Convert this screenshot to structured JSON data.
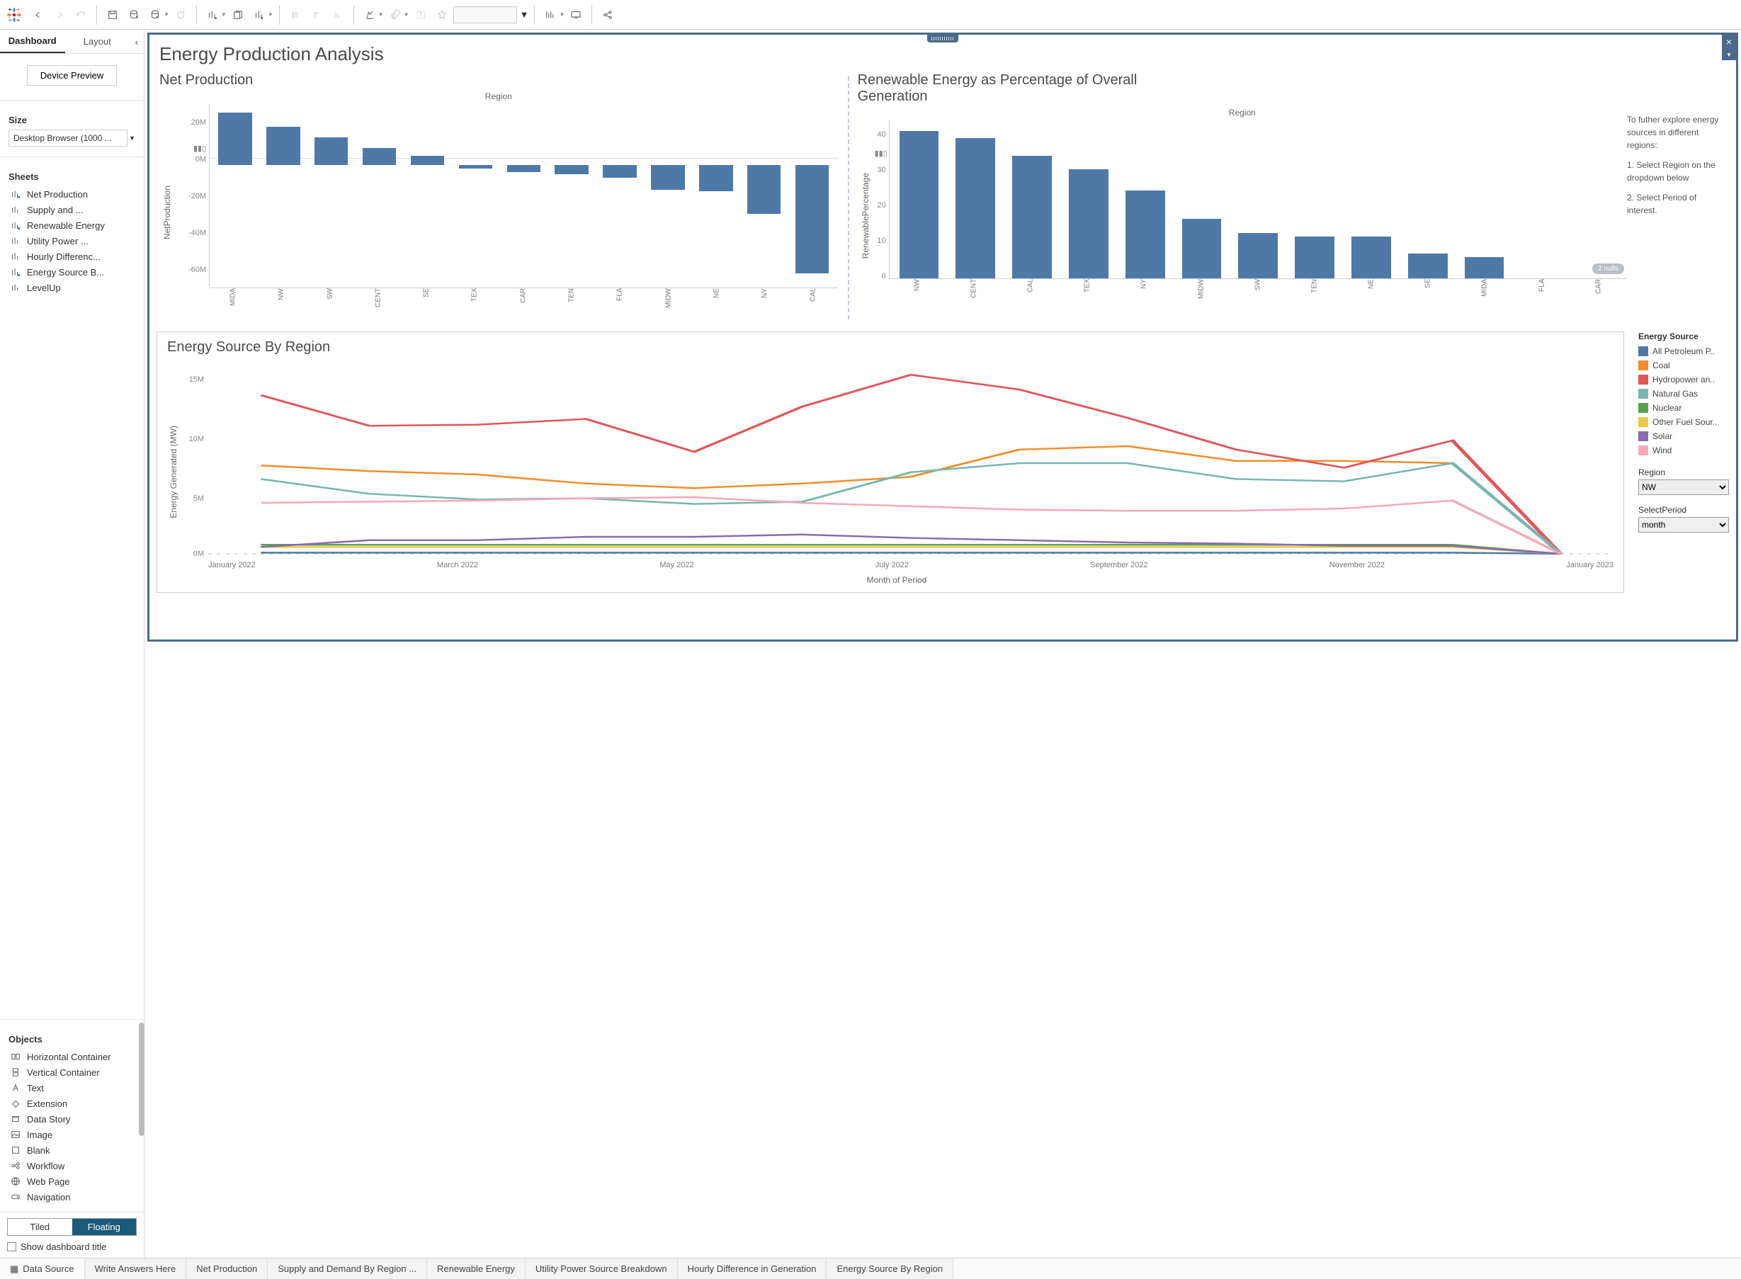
{
  "toolbar": {
    "filter_box": ""
  },
  "left_panel": {
    "tabs": {
      "dashboard": "Dashboard",
      "layout": "Layout"
    },
    "device_preview": "Device Preview",
    "size_heading": "Size",
    "size_value": "Desktop Browser (1000 ...",
    "sheets_heading": "Sheets",
    "sheets": [
      {
        "name": "Net Production"
      },
      {
        "name": "Supply and ..."
      },
      {
        "name": "Renewable Energy"
      },
      {
        "name": "Utility Power ..."
      },
      {
        "name": "Hourly Differenc..."
      },
      {
        "name": "Energy Source B..."
      },
      {
        "name": "LevelUp"
      }
    ],
    "objects_heading": "Objects",
    "objects": [
      {
        "name": "Horizontal Container"
      },
      {
        "name": "Vertical Container"
      },
      {
        "name": "Text"
      },
      {
        "name": "Extension"
      },
      {
        "name": "Data Story"
      },
      {
        "name": "Image"
      },
      {
        "name": "Blank"
      },
      {
        "name": "Workflow"
      },
      {
        "name": "Web Page"
      },
      {
        "name": "Navigation"
      }
    ],
    "toggle": {
      "tiled": "Tiled",
      "floating": "Floating"
    },
    "show_title": "Show dashboard title"
  },
  "dashboard": {
    "title": "Energy Production Analysis",
    "net_production": {
      "title": "Net Production",
      "region_label": "Region",
      "y_axis_label": "NetProduction",
      "y_ticks": [
        "20M",
        "0M",
        "-20M",
        "-40M",
        "-60M"
      ]
    },
    "renewable": {
      "title": "Renewable Energy as Percentage of Overall Generation",
      "region_label": "Region",
      "y_axis_label": "RenewablePercentage",
      "y_ticks": [
        "40",
        "30",
        "20",
        "10",
        "0"
      ],
      "nulls_badge": "2 nulls"
    },
    "side_text": {
      "p1": "To futher explore energy sources in different regions:",
      "p2": "1. Select Region on the dropdown below",
      "p3": "2. Select Period of interest."
    },
    "energy_source": {
      "title": "Energy Source By Region",
      "y_axis_label": "Energy Generated (MW)",
      "y_ticks": [
        "15M",
        "10M",
        "5M",
        "0M"
      ],
      "x_axis_caption": "Month of Period",
      "x_labels": [
        "January 2022",
        "March 2022",
        "May 2022",
        "July 2022",
        "September 2022",
        "November 2022",
        "January 2023"
      ]
    },
    "legend": {
      "title": "Energy Source",
      "items": [
        {
          "name": "All Petroleum P..",
          "color": "#4e79a7"
        },
        {
          "name": "Coal",
          "color": "#f28e2b"
        },
        {
          "name": "Hydropower an..",
          "color": "#e15759"
        },
        {
          "name": "Natural Gas",
          "color": "#76b7b2"
        },
        {
          "name": "Nuclear",
          "color": "#59a14f"
        },
        {
          "name": "Other Fuel Sour..",
          "color": "#edc948"
        },
        {
          "name": "Solar",
          "color": "#8b6bb0"
        },
        {
          "name": "Wind",
          "color": "#f7a8b8"
        }
      ]
    },
    "filters": {
      "region_label": "Region",
      "region_value": "NW",
      "period_label": "SelectPeriod",
      "period_value": "month"
    }
  },
  "bottom_tabs": {
    "data_source": "Data Source",
    "tabs": [
      "Write Answers Here",
      "Net Production",
      "Supply and Demand By Region ...",
      "Renewable Energy",
      "Utility Power Source Breakdown",
      "Hourly Difference in Generation",
      "Energy Source By Region"
    ]
  },
  "chart_data": [
    {
      "type": "bar",
      "title": "Net Production",
      "ylabel": "NetProduction",
      "ylim": [
        -70000000,
        35000000
      ],
      "categories": [
        "MIDA",
        "NW",
        "SW",
        "CENT",
        "SE",
        "TEX",
        "CAR",
        "TEN",
        "FLA",
        "MIDW",
        "NE",
        "NY",
        "CAL"
      ],
      "values": [
        30000000,
        22000000,
        16000000,
        10000000,
        5500000,
        -2000000,
        -4000000,
        -5000000,
        -7000000,
        -14000000,
        -15000000,
        -28000000,
        -62000000
      ]
    },
    {
      "type": "bar",
      "title": "Renewable Energy as Percentage of Overall Generation",
      "ylabel": "RenewablePercentage",
      "ylim": [
        0,
        45
      ],
      "categories": [
        "NW",
        "CENT",
        "CAL",
        "TEX",
        "NY",
        "MIDW",
        "SW",
        "TEN",
        "NE",
        "SE",
        "MIDA",
        "FLA",
        "CAR"
      ],
      "values": [
        42,
        40,
        35,
        31,
        25,
        17,
        13,
        12,
        12,
        7,
        6,
        null,
        null
      ]
    },
    {
      "type": "line",
      "title": "Energy Source By Region",
      "xlabel": "Month of Period",
      "ylabel": "Energy Generated (MW)",
      "ylim": [
        0,
        17000000
      ],
      "x": [
        "Jan 2022",
        "Feb 2022",
        "Mar 2022",
        "Apr 2022",
        "May 2022",
        "Jun 2022",
        "Jul 2022",
        "Aug 2022",
        "Sep 2022",
        "Oct 2022",
        "Nov 2022",
        "Dec 2022",
        "Jan 2023"
      ],
      "series": [
        {
          "name": "All Petroleum P..",
          "color": "#4e79a7",
          "values": [
            100000,
            100000,
            100000,
            100000,
            100000,
            100000,
            100000,
            100000,
            100000,
            100000,
            100000,
            100000,
            0
          ]
        },
        {
          "name": "Coal",
          "color": "#f28e2b",
          "values": [
            7800000,
            7300000,
            7000000,
            6200000,
            5800000,
            6200000,
            6800000,
            9200000,
            9500000,
            8200000,
            8200000,
            8000000,
            0
          ]
        },
        {
          "name": "Hydropower an..",
          "color": "#e15759",
          "values": [
            14000000,
            11300000,
            11400000,
            11900000,
            9000000,
            13000000,
            15800000,
            14500000,
            12000000,
            9200000,
            7600000,
            10000000,
            0
          ]
        },
        {
          "name": "Natural Gas",
          "color": "#76b7b2",
          "values": [
            6600000,
            5300000,
            4800000,
            4900000,
            4400000,
            4600000,
            7200000,
            8000000,
            8000000,
            6600000,
            6400000,
            8000000,
            0
          ]
        },
        {
          "name": "Nuclear",
          "color": "#59a14f",
          "values": [
            800000,
            800000,
            800000,
            800000,
            800000,
            800000,
            800000,
            800000,
            800000,
            800000,
            800000,
            800000,
            0
          ]
        },
        {
          "name": "Other Fuel Sour..",
          "color": "#edc948",
          "values": [
            600000,
            600000,
            600000,
            600000,
            600000,
            600000,
            600000,
            600000,
            600000,
            600000,
            600000,
            600000,
            0
          ]
        },
        {
          "name": "Solar",
          "color": "#8b6bb0",
          "values": [
            600000,
            1200000,
            1200000,
            1500000,
            1500000,
            1700000,
            1400000,
            1200000,
            1000000,
            900000,
            700000,
            700000,
            0
          ]
        },
        {
          "name": "Wind",
          "color": "#f7a8b8",
          "values": [
            4500000,
            4600000,
            4700000,
            4900000,
            5000000,
            4500000,
            4200000,
            3900000,
            3800000,
            3800000,
            4000000,
            4700000,
            0
          ]
        }
      ]
    }
  ]
}
